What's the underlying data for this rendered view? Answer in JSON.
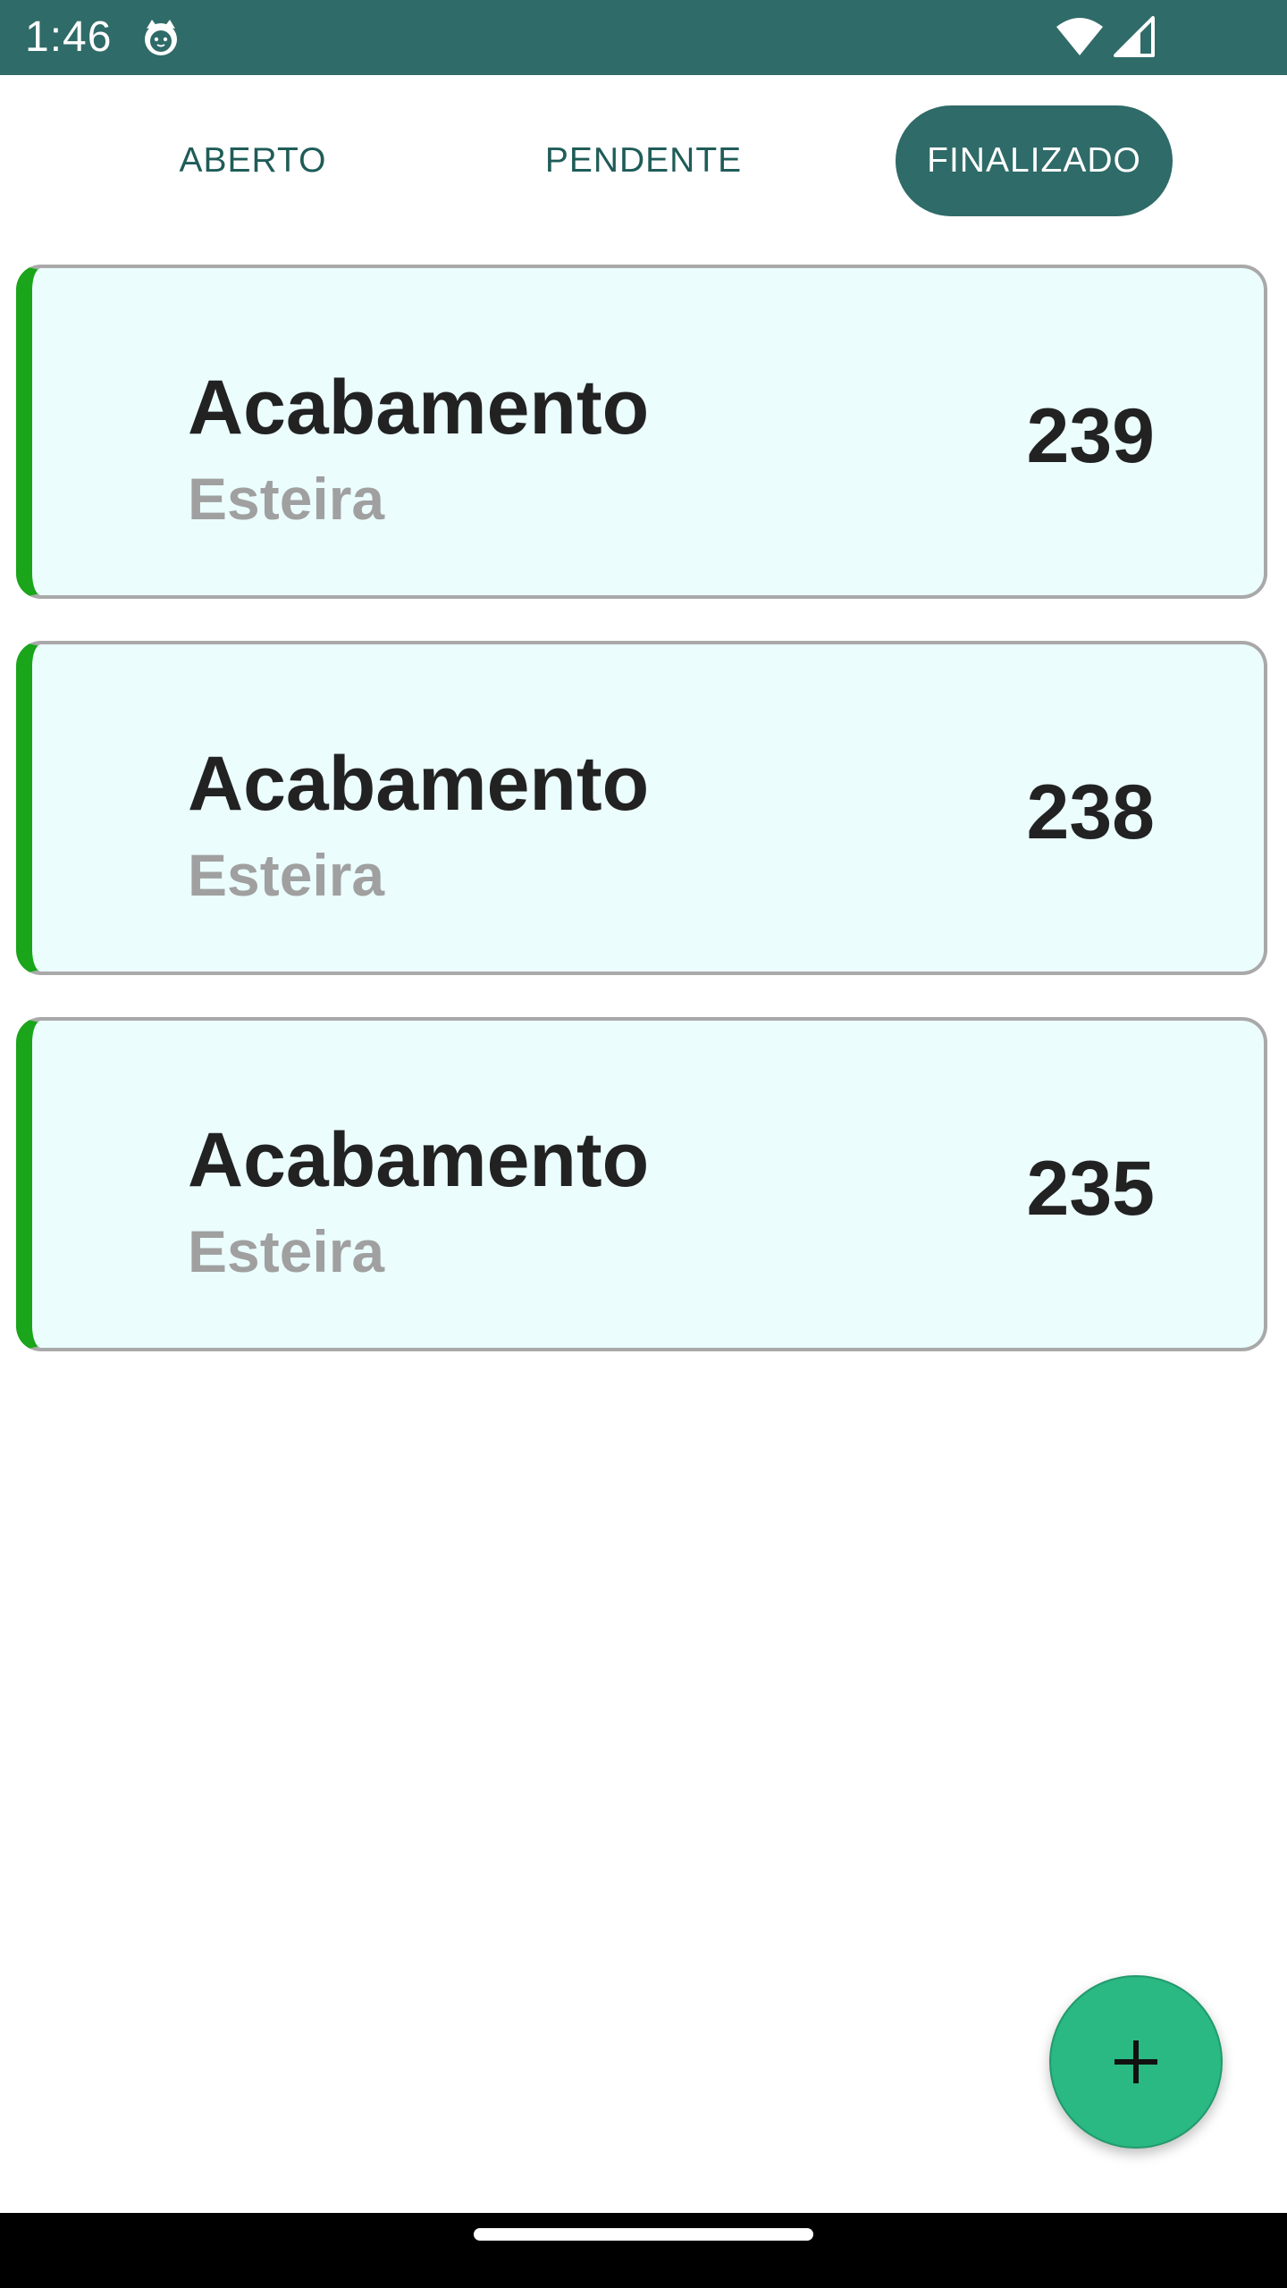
{
  "status_bar": {
    "time": "1:46",
    "icons": [
      "cat-notification-icon",
      "wifi-icon",
      "signal-icon"
    ]
  },
  "tabs": [
    {
      "label": "ABERTO",
      "selected": false
    },
    {
      "label": "PENDENTE",
      "selected": false
    },
    {
      "label": "FINALIZADO",
      "selected": true
    }
  ],
  "items": [
    {
      "title": "Acabamento",
      "subtitle": "Esteira",
      "number": "239"
    },
    {
      "title": "Acabamento",
      "subtitle": "Esteira",
      "number": "238"
    },
    {
      "title": "Acabamento",
      "subtitle": "Esteira",
      "number": "235"
    }
  ],
  "fab": {
    "icon": "plus-icon"
  },
  "colors": {
    "primary": "#2f6b68",
    "card_background": "#ebfdfd",
    "card_accent": "#1aa51a",
    "fab": "#2ab883"
  }
}
